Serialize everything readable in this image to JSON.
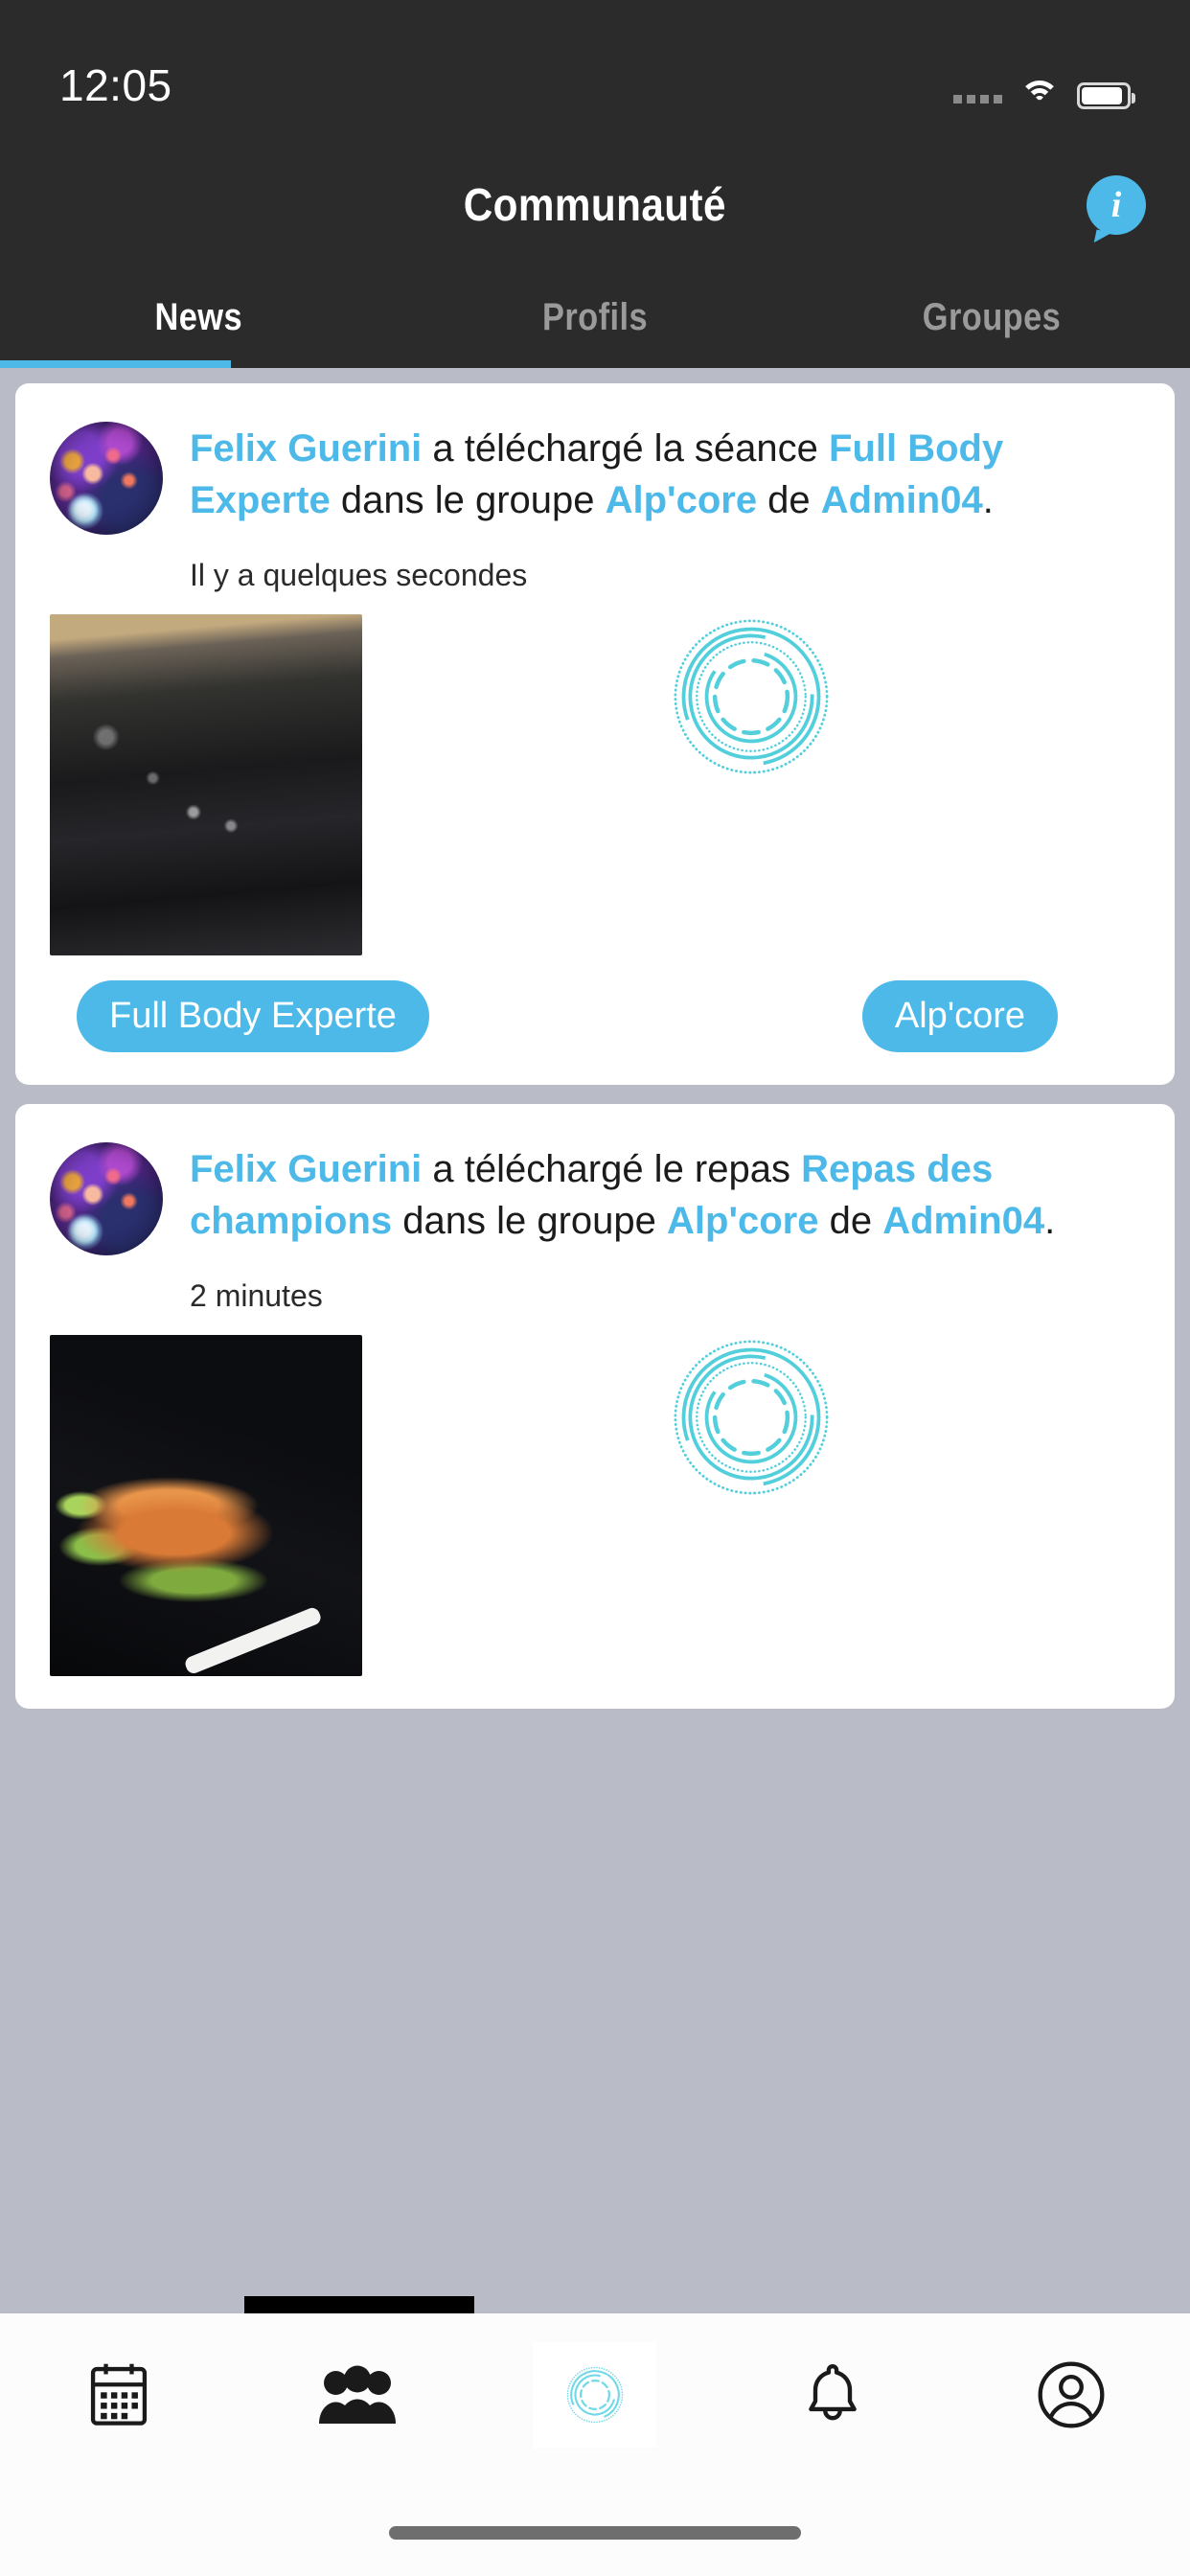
{
  "status_bar": {
    "time": "12:05",
    "signal_icon": "signal-dots-icon",
    "wifi_icon": "wifi-icon",
    "battery_icon": "battery-icon"
  },
  "header": {
    "title": "Communauté",
    "info_button_label": "i",
    "info_icon": "info-bubble-icon"
  },
  "tabs": [
    {
      "label": "News",
      "active": true
    },
    {
      "label": "Profils",
      "active": false
    },
    {
      "label": "Groupes",
      "active": false
    }
  ],
  "colors": {
    "accent": "#4cb9e8",
    "header_bg": "#2b2b2b",
    "page_bg": "#b9bcc6",
    "card_bg": "#ffffff",
    "text": "#1b1b1b"
  },
  "posts": [
    {
      "avatar_icon": "galaxy-avatar",
      "text": {
        "user": "Felix Guerini",
        "action_1": " a téléchargé la séance ",
        "item": "Full Body Experte",
        "action_2": " dans le groupe ",
        "group": "Alp'core",
        "action_3": " de ",
        "owner": "Admin04",
        "action_4": "."
      },
      "timestamp": "Il y a quelques secondes",
      "image_name": "dumbbell-rack-photo",
      "logo_icon": "alpcore-rings-logo",
      "pill_left": "Full Body Experte",
      "pill_right": "Alp'core"
    },
    {
      "avatar_icon": "galaxy-avatar",
      "text": {
        "user": "Felix Guerini",
        "action_1": " a téléchargé le repas ",
        "item": "Repas des champions",
        "action_2": " dans le groupe ",
        "group": "Alp'core",
        "action_3": " de ",
        "owner": "Admin04",
        "action_4": "."
      },
      "timestamp": "2 minutes",
      "image_name": "salmon-plate-photo",
      "logo_icon": "alpcore-rings-logo"
    }
  ],
  "bottom_nav": [
    {
      "icon": "calendar-icon",
      "active": false
    },
    {
      "icon": "people-group-icon",
      "active": false
    },
    {
      "icon": "alpcore-rings-icon",
      "active": true
    },
    {
      "icon": "bell-icon",
      "active": false
    },
    {
      "icon": "profile-person-icon",
      "active": false
    }
  ]
}
